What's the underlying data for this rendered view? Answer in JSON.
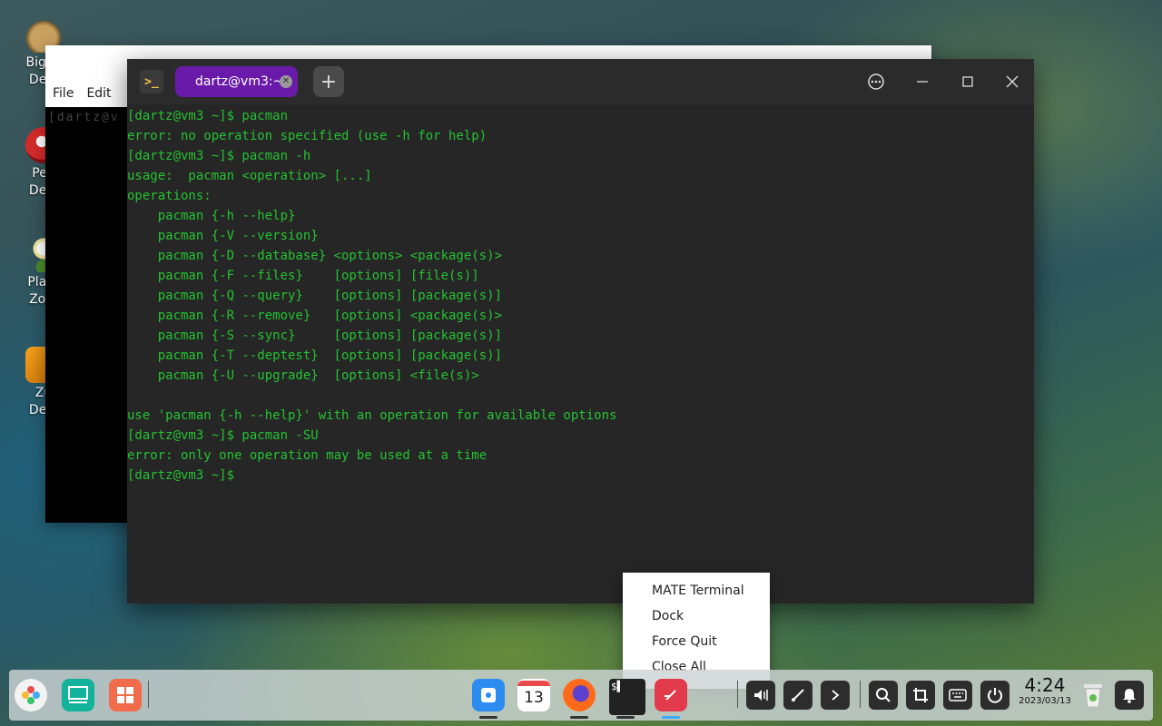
{
  "desktop": {
    "icons": [
      {
        "label_1": "Big M",
        "label_2": "Delu",
        "icon": "money-bag-icon"
      },
      {
        "label_1": "Peg",
        "label_2": "Delu",
        "icon": "peggle-icon"
      },
      {
        "label_1": "Plant",
        "label_2": "Zom",
        "icon": "plants-zombies-icon"
      },
      {
        "label_1": "Zu",
        "label_2": "Delu",
        "icon": "zuma-icon"
      }
    ]
  },
  "bg_window": {
    "menu_file": "File",
    "menu_edit": "Edit",
    "ghost_text": "[dartz@v"
  },
  "terminal": {
    "tab_title": "dartz@vm3:~",
    "app_icon_text": ">_",
    "lines": [
      "[dartz@vm3 ~]$ pacman",
      "error: no operation specified (use -h for help)",
      "[dartz@vm3 ~]$ pacman -h",
      "usage:  pacman <operation> [...]",
      "operations:",
      "    pacman {-h --help}",
      "    pacman {-V --version}",
      "    pacman {-D --database} <options> <package(s)>",
      "    pacman {-F --files}    [options] [file(s)]",
      "    pacman {-Q --query}    [options] [package(s)]",
      "    pacman {-R --remove}   [options] <package(s)>",
      "    pacman {-S --sync}     [options] [package(s)]",
      "    pacman {-T --deptest}  [options] [package(s)]",
      "    pacman {-U --upgrade}  [options] <file(s)>",
      "",
      "use 'pacman {-h --help}' with an operation for available options",
      "[dartz@vm3 ~]$ pacman -SU",
      "error: only one operation may be used at a time",
      "[dartz@vm3 ~]$"
    ],
    "text_color": "#25c232",
    "tab_color": "#6a1aa8"
  },
  "context_menu": {
    "items": [
      "MATE Terminal",
      "Dock",
      "Force Quit",
      "Close All"
    ]
  },
  "dock": {
    "calendar_day": "13",
    "time": "4:24",
    "date": "2023/03/13"
  }
}
